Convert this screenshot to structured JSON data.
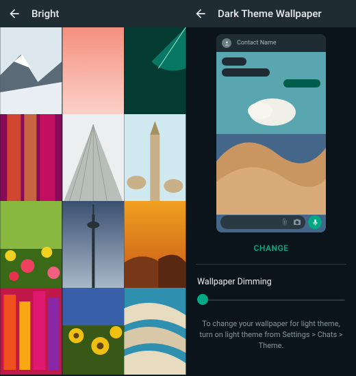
{
  "left": {
    "title": "Bright",
    "thumbs": [
      {
        "name": "mountain-snow",
        "bg": "#e8f0f4"
      },
      {
        "name": "pink-gradient",
        "bg": "#f8b0a0"
      },
      {
        "name": "teal-wave",
        "bg": "#0c7a6a"
      },
      {
        "name": "magenta-abstract",
        "bg": "#b01070"
      },
      {
        "name": "pyramid",
        "bg": "#d8d8d8"
      },
      {
        "name": "mosque-tower",
        "bg": "#d8ecf4"
      },
      {
        "name": "flower-field",
        "bg": "#e0c020"
      },
      {
        "name": "city-tower",
        "bg": "#5a7088"
      },
      {
        "name": "desert-sunset",
        "bg": "#d88030"
      },
      {
        "name": "neon-market",
        "bg": "#e02060"
      },
      {
        "name": "sunflowers-sky",
        "bg": "#4a6a28"
      },
      {
        "name": "sand-ripples",
        "bg": "#d8d0b8"
      }
    ]
  },
  "right": {
    "title": "Dark Theme Wallpaper",
    "contactLabel": "Contact Name",
    "changeLabel": "CHANGE",
    "dimmingLabel": "Wallpaper Dimming",
    "hint": "To change your wallpaper for light theme, turn on light theme from Settings > Chats > Theme.",
    "accent": "#00a884"
  }
}
